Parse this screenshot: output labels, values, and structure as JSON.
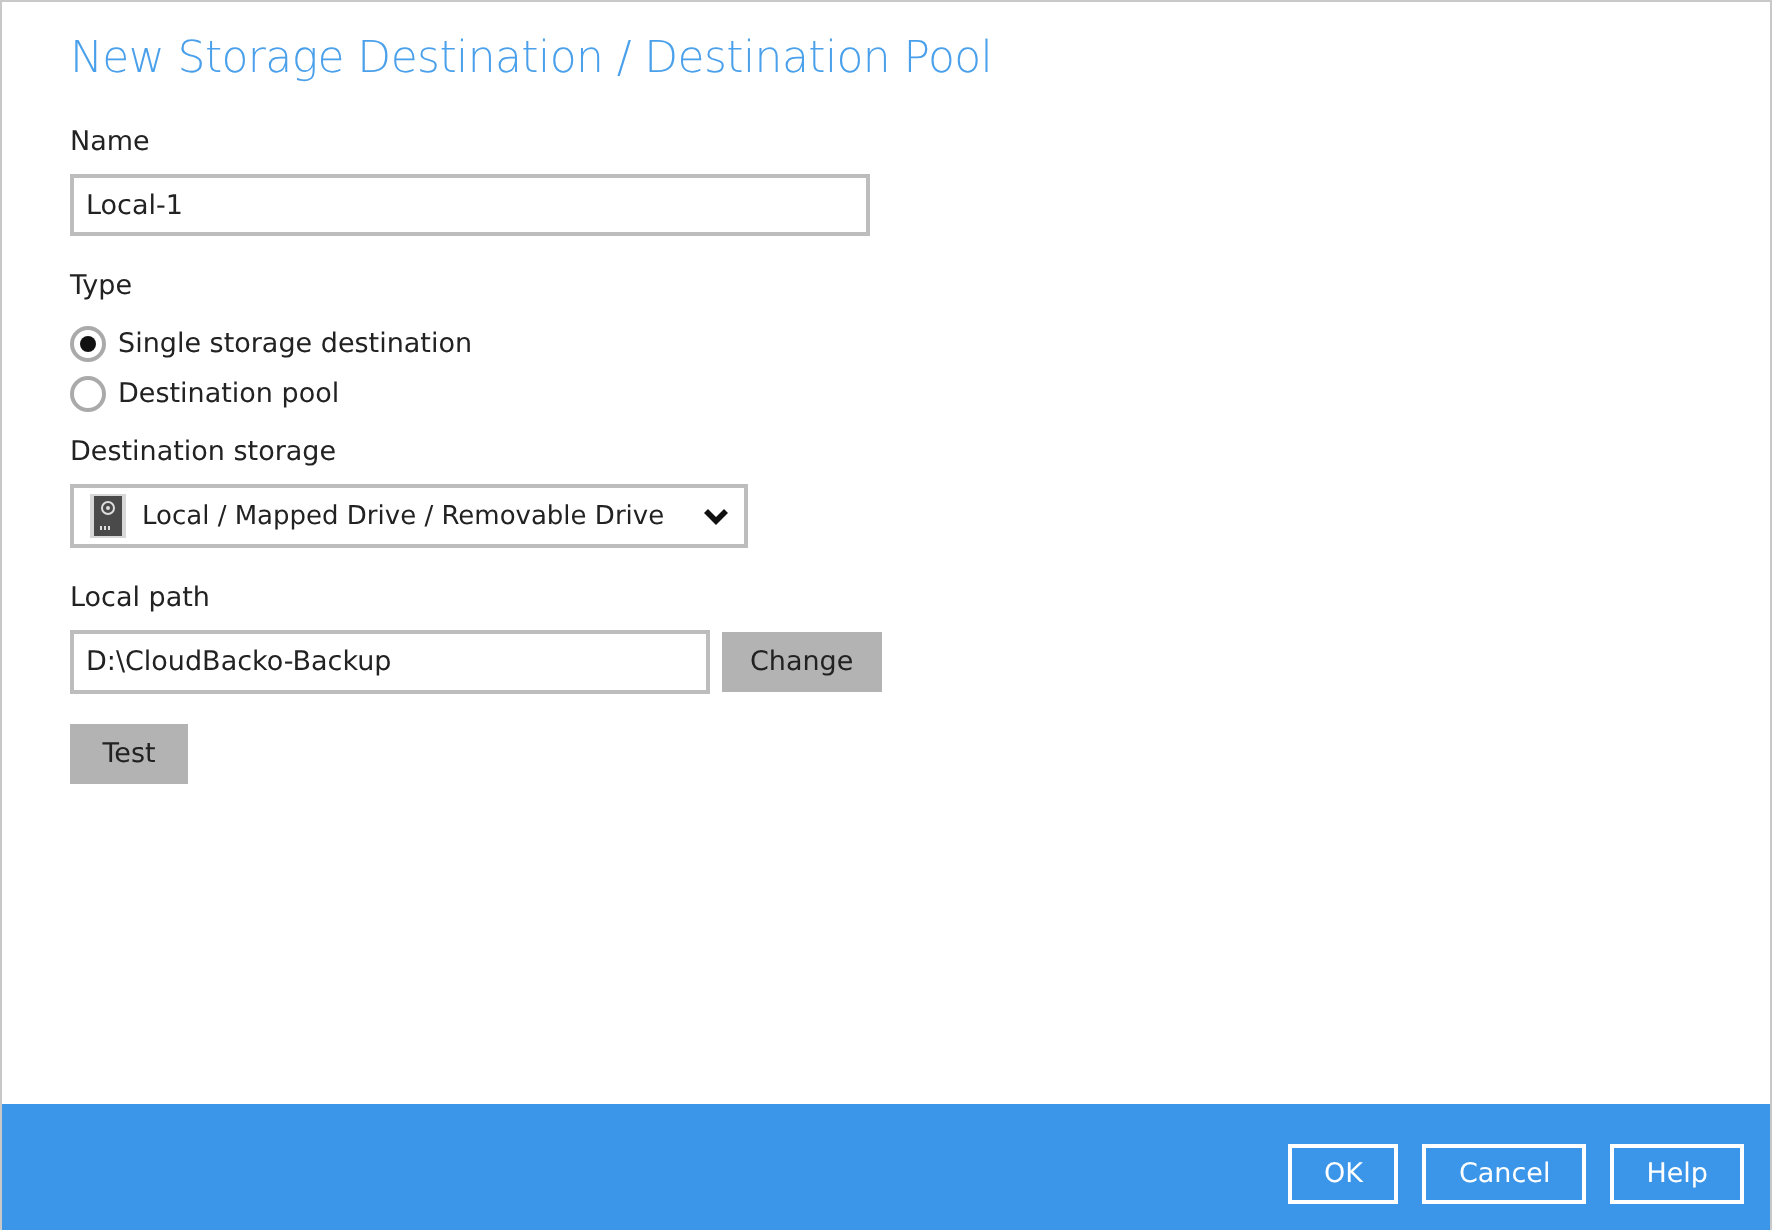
{
  "title": "New Storage Destination / Destination Pool",
  "name": {
    "label": "Name",
    "value": "Local-1"
  },
  "type": {
    "label": "Type",
    "options": [
      {
        "label": "Single storage destination",
        "selected": true
      },
      {
        "label": "Destination pool",
        "selected": false
      }
    ]
  },
  "destination_storage": {
    "label": "Destination storage",
    "value": "Local / Mapped Drive / Removable Drive"
  },
  "local_path": {
    "label": "Local path",
    "value": "D:\\CloudBacko-Backup",
    "button": "Change"
  },
  "test_button": "Test",
  "footer_buttons": [
    "OK",
    "Cancel",
    "Help"
  ]
}
